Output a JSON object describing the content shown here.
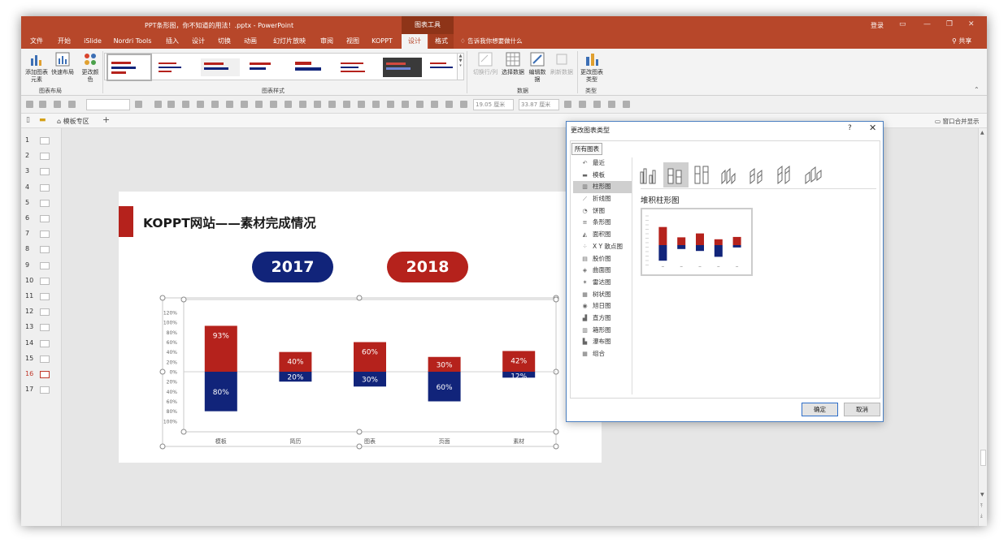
{
  "window": {
    "title": "PPT条形图，你不知道的用法！.pptx - PowerPoint",
    "context_tab": "图表工具",
    "login": "登录",
    "share": "共享",
    "tell_me": "告诉我你想要做什么",
    "tabs": [
      "文件",
      "开始",
      "iSlide",
      "Nordri Tools",
      "插入",
      "设计",
      "切换",
      "动画",
      "幻灯片放映",
      "审阅",
      "视图",
      "KOPPT",
      "设计",
      "格式"
    ],
    "active_tab_index": 12
  },
  "ribbon": {
    "add_element": "添加图表元素",
    "quick_layout": "快速布局",
    "change_colors": "更改颜色",
    "group_layout": "图表布局",
    "group_styles": "图表样式",
    "switch_rowcol": "切换行/列",
    "select_data": "选择数据",
    "edit_data": "编辑数据",
    "refresh_data": "刷新数据",
    "group_data": "数据",
    "change_type": "更改图表类型",
    "group_type": "类型"
  },
  "toolbar2": {
    "width_value": "19.05 厘米",
    "height_value": "33.87 厘米"
  },
  "tabbar": {
    "template": "模板专区",
    "merge": "窗口合并显示"
  },
  "thumbnails": [
    "1",
    "2",
    "3",
    "4",
    "5",
    "6",
    "7",
    "8",
    "9",
    "10",
    "11",
    "12",
    "13",
    "14",
    "15",
    "16",
    "17"
  ],
  "active_thumbnail": "16",
  "slide": {
    "title": "KOPPT网站——素材完成情况",
    "badge_2017": "2017",
    "badge_2018": "2018"
  },
  "chart_data": {
    "type": "bar",
    "stacked": true,
    "categories": [
      "模板",
      "简历",
      "图表",
      "页面",
      "素材"
    ],
    "series": [
      {
        "values": [
          93,
          40,
          60,
          30,
          42
        ],
        "color": "#b5221c",
        "direction": "up"
      },
      {
        "values": [
          80,
          20,
          30,
          60,
          12
        ],
        "color": "#11247a",
        "direction": "down"
      }
    ],
    "ylim": [
      -120,
      120
    ],
    "y_tick_labels": [
      "120%",
      "100%",
      "80%",
      "60%",
      "40%",
      "20%",
      "0%",
      "20%",
      "40%",
      "60%",
      "80%",
      "100%"
    ],
    "grid": false
  },
  "dialog": {
    "title": "更改图表类型",
    "help": "?",
    "close": "✕",
    "tab": "所有图表",
    "categories": [
      "最近",
      "模板",
      "柱形图",
      "折线图",
      "饼图",
      "条形图",
      "面积图",
      "X Y 散点图",
      "股价图",
      "曲面图",
      "雷达图",
      "树状图",
      "旭日图",
      "直方图",
      "箱形图",
      "瀑布图",
      "组合"
    ],
    "category_icons": [
      "↶",
      "▬",
      "▥",
      "⟋",
      "◔",
      "≡",
      "◭",
      "⁘",
      "▤",
      "◈",
      "✶",
      "▦",
      "◉",
      "▟",
      "▥",
      "▙",
      "▦"
    ],
    "selected_category_index": 2,
    "selected_subtype_name": "堆积柱形图",
    "ok": "确定",
    "cancel": "取消"
  },
  "colors": {
    "brand": "#b7472a",
    "red": "#b5221c",
    "navy": "#11247a"
  }
}
